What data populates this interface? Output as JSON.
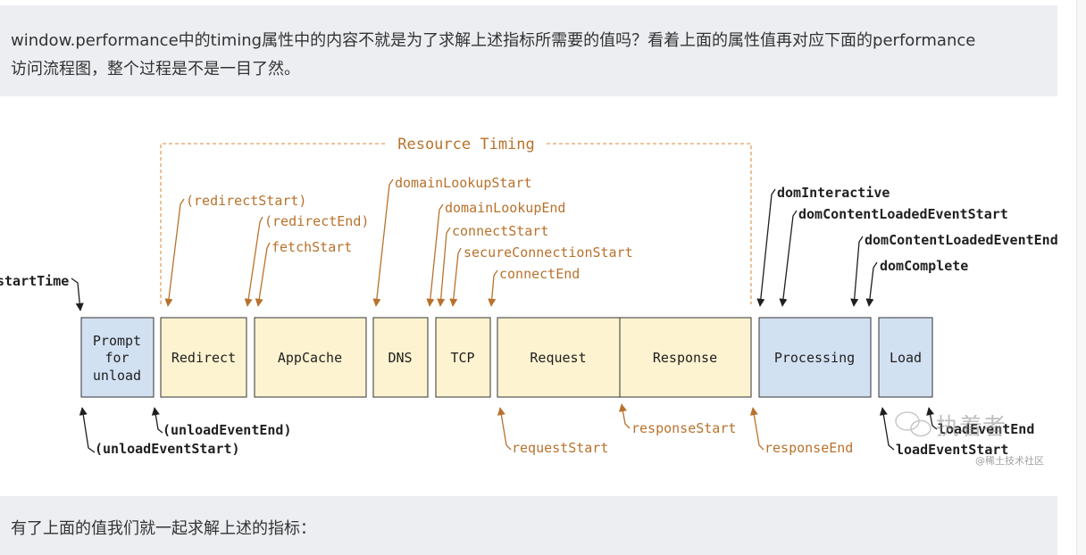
{
  "notes": {
    "top_line1": "window.performance中的timing属性中的内容不就是为了求解上述指标所需要的值吗？看着上面的属性值再对应下面的performance",
    "top_line2": "访问流程图，整个过程是不是一目了然。",
    "bottom": "有了上面的值我们就一起求解上述的指标："
  },
  "diagram": {
    "title": "Resource Timing",
    "boxes": {
      "prompt_line1": "Prompt",
      "prompt_line2": "for",
      "prompt_line3": "unload",
      "redirect": "Redirect",
      "appcache": "AppCache",
      "dns": "DNS",
      "tcp": "TCP",
      "request": "Request",
      "response": "Response",
      "processing": "Processing",
      "load": "Load"
    },
    "labels": {
      "start_time": "startTime",
      "redirect_start": "(redirectStart)",
      "redirect_end": "(redirectEnd)",
      "fetch_start": "fetchStart",
      "domain_lookup_start": "domainLookupStart",
      "domain_lookup_end": "domainLookupEnd",
      "connect_start": "connectStart",
      "secure_connection_start": "secureConnectionStart",
      "connect_end": "connectEnd",
      "dom_interactive": "domInteractive",
      "dom_content_loaded_event_start": "domContentLoadedEventStart",
      "dom_content_loaded_event_end": "domContentLoadedEventEnd",
      "dom_complete": "domComplete",
      "unload_event_end": "(unloadEventEnd)",
      "unload_event_start": "(unloadEventStart)",
      "request_start": "requestStart",
      "response_start": "responseStart",
      "response_end": "responseEnd",
      "load_event_end": "loadEventEnd",
      "load_event_start": "loadEventStart"
    },
    "watermark": {
      "main": "执着者",
      "sub": "@稀土技术社区"
    },
    "colors": {
      "resource_box": "#fdf3d0",
      "browser_box": "#d2e1f2",
      "resource_text": "#b8722c",
      "browser_text": "#1f1f1f"
    }
  }
}
